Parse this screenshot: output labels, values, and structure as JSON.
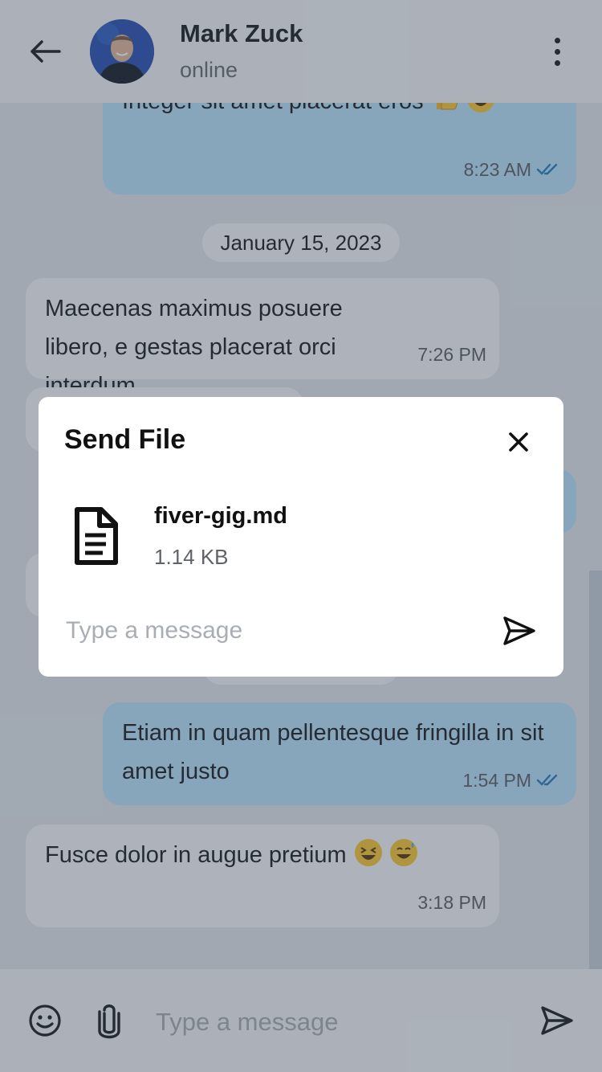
{
  "header": {
    "contact_name": "Mark Zuck",
    "status": "online"
  },
  "messages": [
    {
      "direction": "out",
      "text": "Integer sit amet placerat eros",
      "emojis": [
        "thumbs-up",
        "laughing"
      ],
      "time": "8:23 AM",
      "read": true
    },
    {
      "type": "date",
      "text": "January 15, 2023"
    },
    {
      "direction": "in",
      "text": "Maecenas maximus posuere libero, e gestas placerat orci interdum",
      "time": "7:26 PM"
    },
    {
      "direction": "out",
      "text": "Etiam in quam pellentesque fringilla in sit amet justo",
      "time": "1:54 PM",
      "read": true
    },
    {
      "direction": "in",
      "text": "Fusce dolor in augue pretium",
      "emojis": [
        "laughing",
        "sweat-smile"
      ],
      "time": "3:18 PM"
    }
  ],
  "composer": {
    "placeholder": "Type a message"
  },
  "modal": {
    "title": "Send File",
    "file_name": "fiver-gig.md",
    "file_size": "1.14 KB",
    "placeholder": "Type a message"
  },
  "colors": {
    "outgoing_bubble": "#b9e3fb",
    "incoming_bubble": "#f6f8fa",
    "read_ticks": "#2f7fc1",
    "overlay": "rgba(46,58,74,0.36)"
  }
}
